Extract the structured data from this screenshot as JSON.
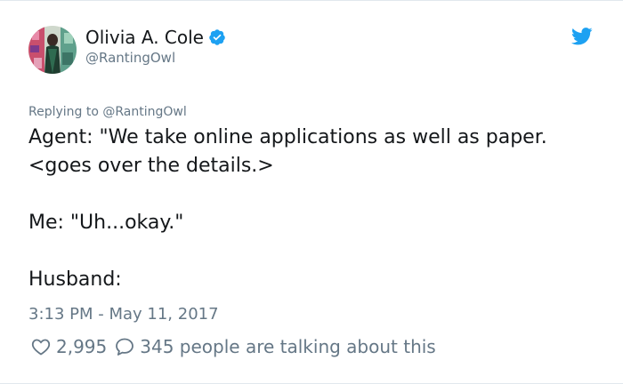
{
  "author": {
    "display_name": "Olivia A. Cole",
    "handle": "@RantingOwl",
    "avatar_icon": "avatar-portrait",
    "verified": true
  },
  "header": {
    "brand_icon": "twitter-bird-icon",
    "brand_color": "#1da1f2"
  },
  "reply": {
    "prefix": "Replying to",
    "handle": "@RantingOwl"
  },
  "tweet": {
    "lines": [
      "Agent: \"We take online applications as well as paper.",
      "<goes over the details.>",
      "Me: \"Uh...okay.\"",
      "Husband:"
    ]
  },
  "timestamp": "3:13 PM - May 11, 2017",
  "engagement": {
    "likes": "2,995",
    "talking": "345 people are talking about this"
  },
  "colors": {
    "secondary_text": "#657786",
    "primary_text": "#14171a",
    "verified_badge": "#1da1f2"
  }
}
